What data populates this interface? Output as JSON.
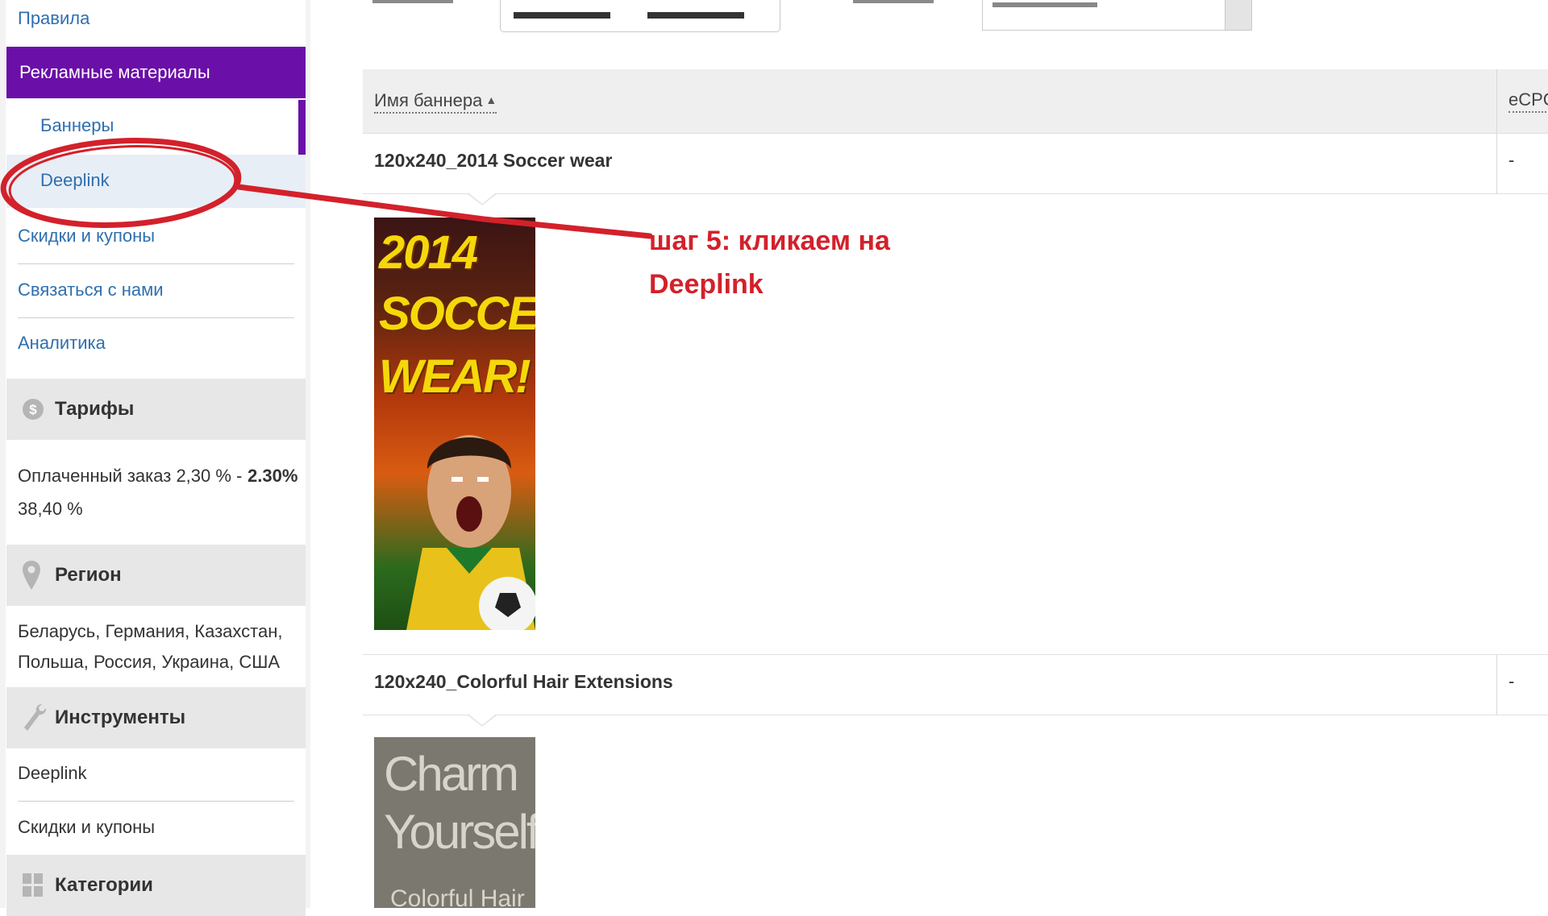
{
  "sidebar": {
    "top_link": "Правила",
    "promo_header": "Рекламные материалы",
    "sub_items": [
      "Баннеры",
      "Deeplink"
    ],
    "links": [
      "Скидки и купоны",
      "Связаться с нами",
      "Аналитика"
    ],
    "tariffs": {
      "header": "Тарифы",
      "line1": "Оплаченный заказ 2,30 % -",
      "line2": "38,40 %",
      "value": "2.30%"
    },
    "region": {
      "header": "Регион",
      "line1": "Беларусь, Германия, Казахстан,",
      "line2": "Польша, Россия, Украина, США"
    },
    "tools": {
      "header": "Инструменты",
      "items": [
        "Deeplink",
        "Скидки и купоны"
      ]
    },
    "categories": {
      "header": "Категории"
    }
  },
  "table": {
    "col_name": "Имя баннера",
    "col_ecpc": "eCPC",
    "rows": [
      {
        "name": "120x240_2014 Soccer wear",
        "ecpc": "-"
      },
      {
        "name": "120x240_Colorful Hair Extensions",
        "ecpc": "-"
      }
    ]
  },
  "banners": {
    "soccer": [
      "2014",
      "SOCCER",
      "WEAR!"
    ],
    "hair": [
      "Charm",
      "Yourself"
    ],
    "hair_sub": "Colorful Hair"
  },
  "annotation": {
    "line1": "шаг 5: кликаем на",
    "line2": "Deeplink",
    "color": "#d3212b"
  },
  "colors": {
    "accent_purple": "#6a0fa8",
    "link_blue": "#2f6fb0"
  }
}
